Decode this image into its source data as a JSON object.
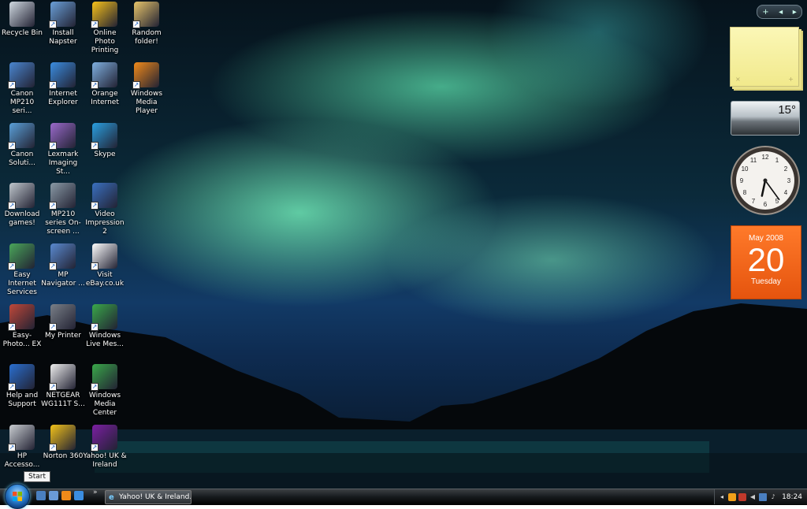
{
  "desktop": {
    "icons": [
      {
        "name": "recycle-bin",
        "label": "Recycle Bin",
        "color": "#cfd8e0"
      },
      {
        "name": "install-napster",
        "label": "Install Napster",
        "color": "#6aa0d8"
      },
      {
        "name": "online-photo-printing",
        "label": "Online Photo Printing",
        "color": "#f7c21a"
      },
      {
        "name": "random-folder",
        "label": "Random folder!",
        "color": "#e6c46a"
      },
      {
        "name": "canon-mp210",
        "label": "Canon MP210 seri...",
        "color": "#4a86d0"
      },
      {
        "name": "internet-explorer",
        "label": "Internet Explorer",
        "color": "#3b8de0"
      },
      {
        "name": "orange-internet",
        "label": "Orange Internet",
        "color": "#7fb0e0"
      },
      {
        "name": "windows-media-player",
        "label": "Windows Media Player",
        "color": "#f08a1a"
      },
      {
        "name": "canon-solution",
        "label": "Canon Soluti...",
        "color": "#5aa0d8"
      },
      {
        "name": "lexmark-imaging",
        "label": "Lexmark Imaging St...",
        "color": "#9a6acb"
      },
      {
        "name": "skype",
        "label": "Skype",
        "color": "#2aa0e0"
      },
      {
        "name": "download-games",
        "label": "Download games!",
        "color": "#bfc6cc"
      },
      {
        "name": "mp210-onscreen",
        "label": "MP210 series On-screen ...",
        "color": "#8a9aa6"
      },
      {
        "name": "video-impression",
        "label": "Video Impression 2",
        "color": "#3a70c0"
      },
      {
        "name": "easy-internet-services",
        "label": "Easy Internet Services",
        "color": "#4aa65a"
      },
      {
        "name": "mp-navigator",
        "label": "MP Navigator ...",
        "color": "#5a8ad0"
      },
      {
        "name": "visit-ebay",
        "label": "Visit eBay.co.uk",
        "color": "#ffffff"
      },
      {
        "name": "easy-photoprint",
        "label": "Easy-Photo... EX",
        "color": "#c0483a"
      },
      {
        "name": "my-printer",
        "label": "My Printer",
        "color": "#7a8088"
      },
      {
        "name": "windows-live-messenger",
        "label": "Windows Live Mes...",
        "color": "#3aa84a"
      },
      {
        "name": "help-and-support",
        "label": "Help and Support",
        "color": "#2a6fd0"
      },
      {
        "name": "netgear",
        "label": "NETGEAR WG111T S...",
        "color": "#eeeeee"
      },
      {
        "name": "windows-media-center",
        "label": "Windows Media Center",
        "color": "#3aa84a"
      },
      {
        "name": "hp-accessories",
        "label": "HP Accesso...",
        "color": "#c8ccd0"
      },
      {
        "name": "norton-360",
        "label": "Norton 360",
        "color": "#f2c21a"
      },
      {
        "name": "yahoo-uk-ireland",
        "label": "Yahoo! UK & Ireland",
        "color": "#7b1fa2"
      }
    ]
  },
  "gadgets": {
    "weather": {
      "temperature": "15°"
    },
    "clock": {
      "hour": 6,
      "minute": 24,
      "numerals": [
        "12",
        "1",
        "2",
        "3",
        "4",
        "5",
        "6",
        "7",
        "8",
        "9",
        "10",
        "11"
      ]
    },
    "calendar": {
      "month_year": "May 2008",
      "day": "20",
      "weekday": "Tuesday"
    },
    "notes": {
      "close_glyph": "×",
      "add_glyph": "+"
    },
    "controls": {
      "add": "+",
      "prev": "◂",
      "next": "▸"
    }
  },
  "taskbar": {
    "start_tooltip": "Start",
    "chevron": "»",
    "window_button": "Yahoo! UK & Ireland...",
    "clock": "18:24",
    "tray_left": "◂"
  },
  "colors": {
    "taskbar": "#15191c",
    "calendar": "#e5540e",
    "notes": "#f7f0a3"
  }
}
